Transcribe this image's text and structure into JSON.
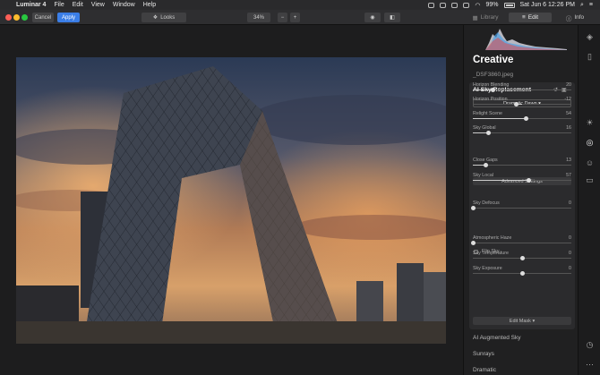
{
  "menubar": {
    "app": "Luminar 4",
    "menus": [
      "File",
      "Edit",
      "View",
      "Window",
      "Help"
    ],
    "battery": "99%",
    "clock": "Sat Jun 6  12:26 PM"
  },
  "toolbar": {
    "cancel": "Cancel",
    "apply": "Apply",
    "looks": "Looks",
    "zoom": "34%",
    "zoom_minus": "−",
    "zoom_plus": "+",
    "tabs": {
      "library": "Library",
      "edit": "Edit",
      "info": "Info"
    }
  },
  "panel": {
    "title": "Creative",
    "filename": "_DSF3860.jpeg",
    "tool": {
      "title": "AI Sky Replacement",
      "sky_select": "Dramatic Dawn ▾",
      "advanced": "Advanced Settings",
      "flip_sky": "Flip Sky",
      "edit_mask": "Edit Mask ▾",
      "sliders": [
        {
          "label": "Horizon Blending",
          "value": "20",
          "pos": 0.2,
          "fill": "left"
        },
        {
          "label": "Horizon Position",
          "value": "-12",
          "pos": 0.44,
          "fill": "center"
        },
        {
          "label": "Relight Scene",
          "value": "54",
          "pos": 0.54,
          "fill": "left"
        },
        {
          "label": "Sky Global",
          "value": "16",
          "pos": 0.16,
          "fill": "left"
        },
        {
          "label": "Close Gaps",
          "value": "13",
          "pos": 0.13,
          "fill": "left"
        },
        {
          "label": "Sky Local",
          "value": "57",
          "pos": 0.57,
          "fill": "left"
        },
        {
          "label": "Sky Defocus",
          "value": "0",
          "pos": 0.0,
          "fill": "left"
        },
        {
          "label": "Atmospheric Haze",
          "value": "0",
          "pos": 0.0,
          "fill": "left"
        },
        {
          "label": "Sky Temperature",
          "value": "0",
          "pos": 0.5,
          "fill": "center"
        },
        {
          "label": "Sky Exposure",
          "value": "0",
          "pos": 0.5,
          "fill": "center"
        }
      ]
    },
    "extras": [
      "AI Augmented Sky",
      "Sunrays",
      "Dramatic"
    ]
  },
  "colors": {
    "accent": "#3b7ee6"
  }
}
